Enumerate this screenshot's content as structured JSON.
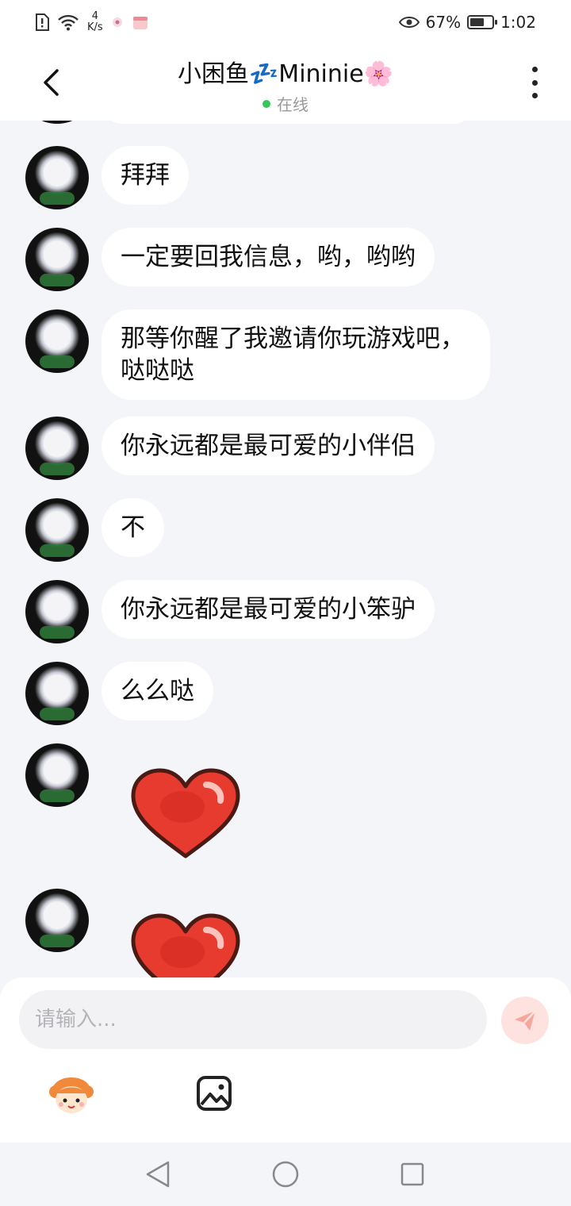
{
  "status_bar": {
    "net_speed_value": "4",
    "net_speed_unit": "K/s",
    "battery_percent": "67%",
    "battery_level": 0.67,
    "time": "1:02"
  },
  "header": {
    "title": "小困鱼💤Mininie🌸",
    "status": "在线"
  },
  "messages": [
    {
      "text": "拜拜"
    },
    {
      "text": "一定要回我信息，哟，哟哟"
    },
    {
      "text": "那等你醒了我邀请你玩游戏吧，哒哒哒"
    },
    {
      "text": "你永远都是最可爱的小伴侣"
    },
    {
      "text": "不"
    },
    {
      "text": "你永远都是最可爱的小笨驴"
    },
    {
      "text": "么么哒"
    }
  ],
  "stickers": [
    {
      "icon": "heart-sticker-icon"
    },
    {
      "icon": "heart-sticker-icon"
    }
  ],
  "input": {
    "placeholder": "请输入..."
  },
  "colors": {
    "background": "#f4f5f9",
    "bubble": "#ffffff",
    "send_button": "#fde2df",
    "online": "#35c75a",
    "heart": "#e63b2e"
  }
}
